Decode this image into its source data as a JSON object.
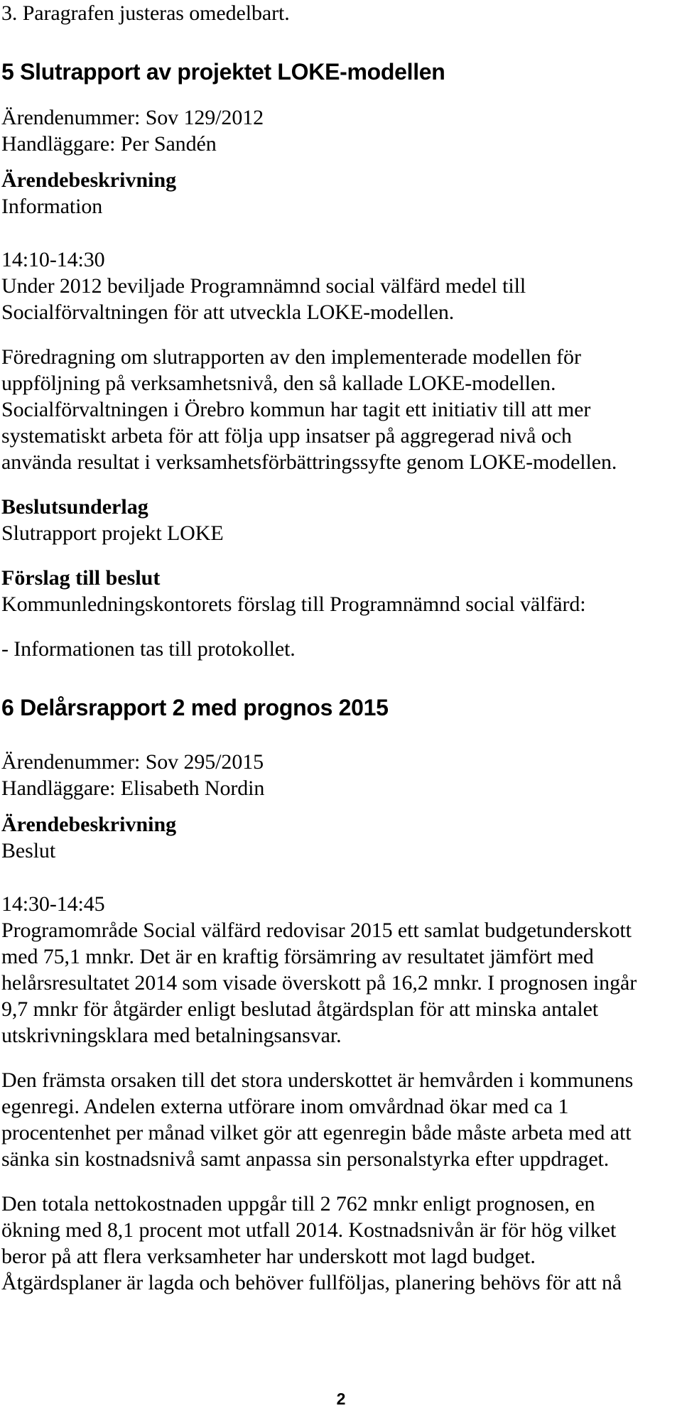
{
  "document": {
    "page_number": "2",
    "continuation_line": "3. Paragrafen justeras omedelbart."
  },
  "items": [
    {
      "heading": "5 Slutrapport av projektet LOKE-modellen",
      "case_number": "Ärendenummer: Sov 129/2012",
      "handler": "Handläggare: Per Sandén",
      "description_label": "Ärendebeskrivning",
      "description_type": "Information",
      "time": "14:10-14:30",
      "body_paragraphs": [
        "Under 2012 beviljade Programnämnd social välfärd medel till\nSocialförvaltningen för att utveckla LOKE-modellen.",
        "Föredragning om slutrapporten av den implementerade modellen för\nuppföljning på verksamhetsnivå, den så kallade LOKE-modellen.\nSocialförvaltningen i Örebro kommun har tagit ett initiativ till att mer\nsystematiskt arbeta för att följa upp insatser på aggregerad nivå och\nanvända resultat i verksamhetsförbättringssyfte genom LOKE-modellen."
      ],
      "basis_label": "Beslutsunderlag",
      "basis_text": "Slutrapport projekt LOKE",
      "proposal_label": "Förslag till beslut",
      "proposal_intro": "Kommunledningskontorets förslag till Programnämnd social välfärd:",
      "proposal_points": [
        "- Informationen tas till protokollet."
      ]
    },
    {
      "heading": "6 Delårsrapport 2 med prognos 2015",
      "case_number": "Ärendenummer: Sov 295/2015",
      "handler": "Handläggare: Elisabeth Nordin",
      "description_label": "Ärendebeskrivning",
      "description_type": "Beslut",
      "time": "14:30-14:45",
      "body_paragraphs": [
        "Programområde Social välfärd redovisar 2015 ett samlat budgetunderskott\nmed 75,1 mnkr. Det är en kraftig försämring av resultatet jämfört med\nhelårsresultatet 2014 som visade överskott på 16,2 mnkr. I prognosen ingår\n9,7 mnkr för åtgärder enligt beslutad åtgärdsplan för att minska antalet\nutskrivningsklara med betalningsansvar.",
        "Den främsta orsaken till det stora underskottet är hemvården i kommunens\negenregi. Andelen externa utförare inom omvårdnad ökar med ca 1\nprocentenhet per månad vilket gör att egenregin både måste arbeta med att\nsänka sin kostnadsnivå samt anpassa sin personalstyrka efter uppdraget.",
        "Den totala nettokostnaden uppgår till 2 762 mnkr enligt prognosen, en\nökning med 8,1 procent mot utfall 2014. Kostnadsnivån är för hög vilket\nberor på att flera verksamheter har underskott mot lagd budget.\nÅtgärdsplaner är lagda och behöver fullföljas, planering behövs för att nå"
      ]
    }
  ]
}
